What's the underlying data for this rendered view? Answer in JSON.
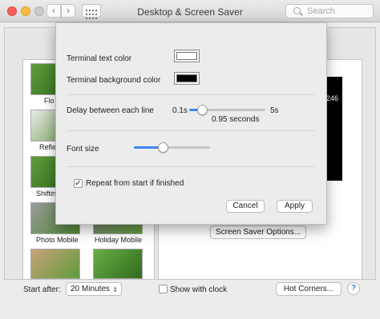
{
  "window": {
    "title": "Desktop & Screen Saver",
    "search_placeholder": "Search",
    "nav": {
      "back": "‹",
      "forward": "›"
    }
  },
  "savers": [
    {
      "label": "Flo"
    },
    {
      "label": "Refle"
    },
    {
      "label": "Shiftin"
    },
    {
      "label": "Photo Mobile"
    },
    {
      "label": "Holiday Mobile"
    }
  ],
  "preview": {
    "text": "246",
    "options_button": "Screen Saver Options..."
  },
  "bottom": {
    "start_after_label": "Start after:",
    "start_after_value": "20 Minutes",
    "show_clock_label": "Show with clock",
    "show_clock_checked": false,
    "hot_corners_button": "Hot Corners...",
    "help": "?"
  },
  "sheet": {
    "text_color_label": "Terminal text color",
    "text_color": "#ffffff",
    "bg_color_label": "Terminal background color",
    "bg_color": "#000000",
    "delay_label": "Delay between each line",
    "delay_min": "0.1s",
    "delay_max": "5s",
    "delay_value_text": "0.95 seconds",
    "delay_fraction": 0.17,
    "font_size_label": "Font size",
    "font_size_fraction": 0.38,
    "repeat_label": "Repeat from start if finished",
    "repeat_checked": true,
    "cancel_button": "Cancel",
    "apply_button": "Apply"
  }
}
